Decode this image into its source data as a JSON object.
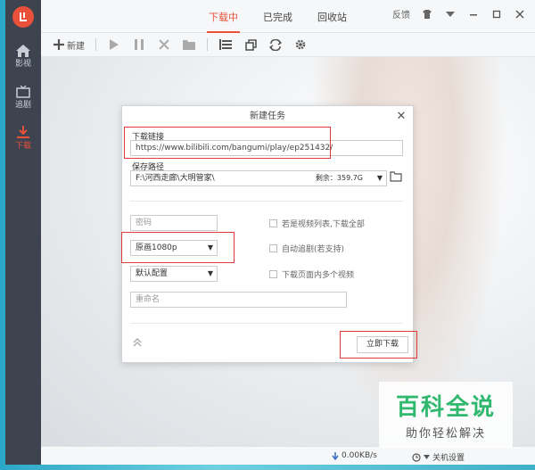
{
  "window": {
    "tabs": [
      {
        "label": "下载中",
        "active": true
      },
      {
        "label": "已完成",
        "active": false
      },
      {
        "label": "回收站",
        "active": false
      }
    ],
    "feedback": "反馈",
    "accent_color": "#e8503a"
  },
  "toolbar": {
    "new_label": "新建"
  },
  "sidebar": {
    "items": [
      {
        "label": "影视",
        "icon": "home-icon"
      },
      {
        "label": "追剧",
        "icon": "tv-icon"
      },
      {
        "label": "下载",
        "icon": "download-icon",
        "active": true
      }
    ]
  },
  "dialog": {
    "title": "新建任务",
    "link_label": "下载链接",
    "link_value": "https://www.bilibili.com/bangumi/play/ep251432/",
    "save_label": "保存路径",
    "save_value": "F:\\河西走廊\\大明管家\\",
    "remaining": "剩余：359.7G",
    "password_placeholder": "密码",
    "quality_value": "原画1080p",
    "config_value": "默认配置",
    "rename_placeholder": "重命名",
    "check_all_episodes": "若是视频列表,下载全部",
    "check_auto_follow": "自动追剧(若支持)",
    "check_multi_video": "下载页面内多个视频",
    "download_button": "立即下载"
  },
  "statusbar": {
    "speed": "0.00KB/s",
    "shutdown": "关机设置"
  },
  "watermark": {
    "main": "百科全说",
    "sub": "助你轻松解决"
  }
}
